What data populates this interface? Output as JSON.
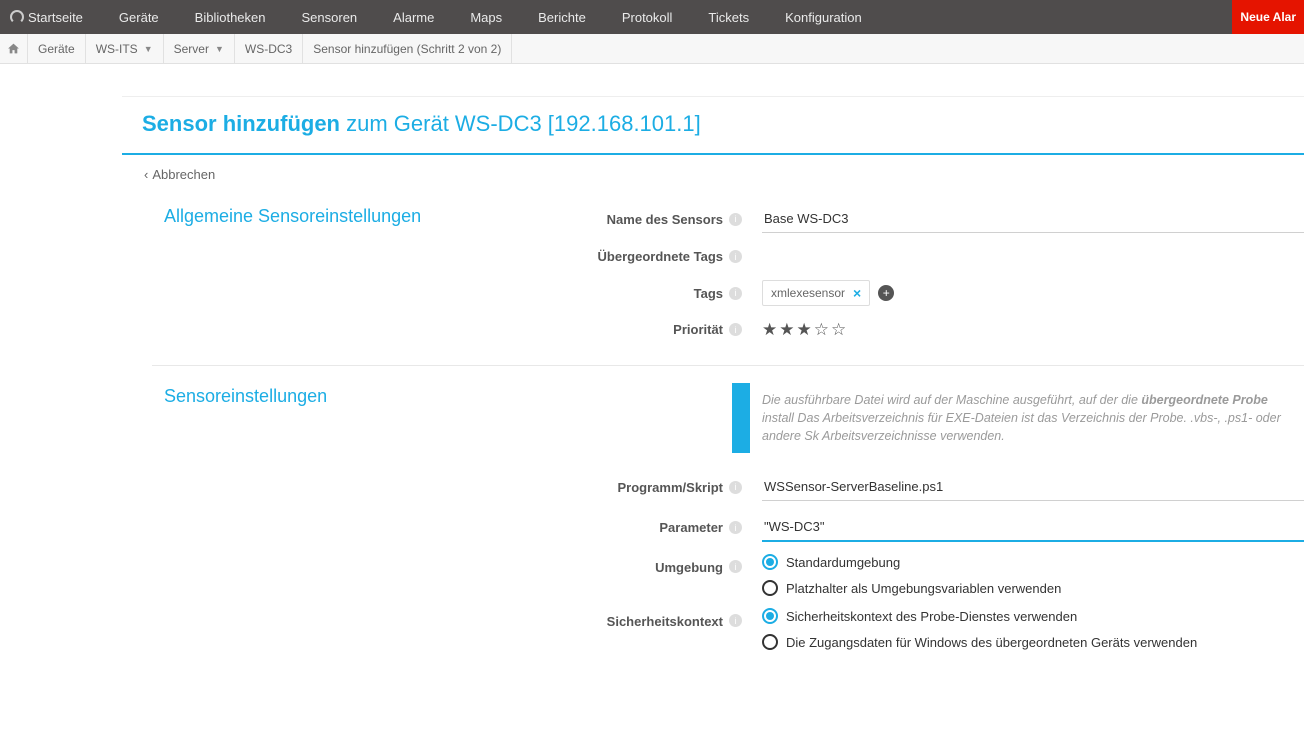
{
  "topnav": {
    "items": [
      "Startseite",
      "Geräte",
      "Bibliotheken",
      "Sensoren",
      "Alarme",
      "Maps",
      "Berichte",
      "Protokoll",
      "Tickets",
      "Konfiguration"
    ],
    "alarm_button": "Neue Alar"
  },
  "breadcrumb": {
    "items": [
      {
        "label": "Geräte",
        "dropdown": false
      },
      {
        "label": "WS-ITS",
        "dropdown": true
      },
      {
        "label": "Server",
        "dropdown": true
      },
      {
        "label": "WS-DC3",
        "dropdown": false
      },
      {
        "label": "Sensor hinzufügen (Schritt 2 von 2)",
        "dropdown": false
      }
    ]
  },
  "page": {
    "title_bold": "Sensor hinzufügen",
    "title_rest": " zum Gerät WS-DC3 [192.168.101.1]",
    "back": "Abbrechen"
  },
  "section1": {
    "heading": "Allgemeine Sensoreinstellungen",
    "name_label": "Name des Sensors",
    "name_value": "Base WS-DC3",
    "parent_tags_label": "Übergeordnete Tags",
    "tags_label": "Tags",
    "tag_value": "xmlexesensor",
    "priority_label": "Priorität",
    "priority_value": 3
  },
  "section2": {
    "heading": "Sensoreinstellungen",
    "callout": "Die ausführbare Datei wird auf der Maschine ausgeführt, auf der die <b>übergeordnete Probe</b> install Das Arbeitsverzeichnis für EXE-Dateien ist das Verzeichnis der Probe. .vbs-, .ps1- oder andere Sk Arbeitsverzeichnisse verwenden.",
    "script_label": "Programm/Skript",
    "script_value": "WSSensor-ServerBaseline.ps1",
    "param_label": "Parameter",
    "param_value": "\"WS-DC3\"",
    "env_label": "Umgebung",
    "env_options": [
      "Standardumgebung",
      "Platzhalter als Umgebungsvariablen verwenden"
    ],
    "env_selected": 0,
    "sec_label": "Sicherheitskontext",
    "sec_options": [
      "Sicherheitskontext des Probe-Dienstes verwenden",
      "Die Zugangsdaten für Windows des übergeordneten Geräts verwenden"
    ],
    "sec_selected": 0
  }
}
